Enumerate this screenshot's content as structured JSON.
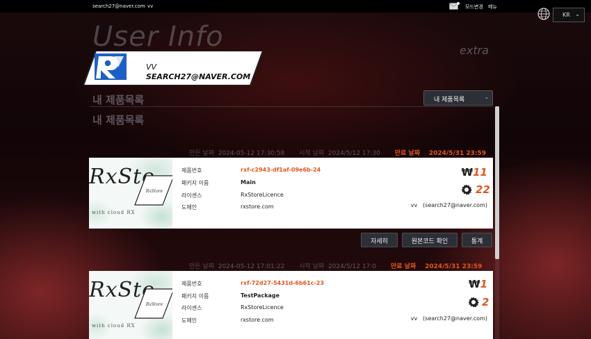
{
  "topbar": {
    "email": "search27@naver.com",
    "nickname": "vv",
    "mode_label": "모드변경",
    "menu_label": "메뉴"
  },
  "lang": {
    "selected": "KR",
    "icon": "globe-icon"
  },
  "page": {
    "title": "User Info",
    "extra": "extra",
    "banner_nickname": "VV",
    "banner_email": "SEARCH27@NAVER.COM",
    "section_title": "내 제품목록",
    "section_subtitle": "내 제품목록",
    "select_value": "내 제품목록"
  },
  "colors": {
    "accent": "#e2571e",
    "button": "#2c3036",
    "card": "#ffffff"
  },
  "products": [
    {
      "created_label": "만든 날짜",
      "created": "2024-05-12 17:30:58",
      "start_label": "시작 날짜",
      "start": "2024/5/12 17:30",
      "expire_label": "만료 날짜",
      "expire": "2024/5/31 23:59",
      "thumb_brand": "RxSto",
      "thumb_logo": "RxStore",
      "thumb_tagline": "with cloud RX",
      "labels": {
        "number": "제품번호",
        "package": "패키지 이름",
        "license": "라이센스",
        "domain": "도메인"
      },
      "number": "rxf-c2943-df1af-09e6b-24",
      "package": "Main",
      "license": "RxStoreLicence",
      "domain": "rxstore.com",
      "currency": "₩",
      "price": "11",
      "count": "22",
      "owner": "vv　(search27@naver.com)"
    },
    {
      "created_label": "만든 날짜",
      "created": "2024-05-12 17:01:22",
      "start_label": "시작 날짜",
      "start": "2024/5/12 17:0",
      "expire_label": "만료 날짜",
      "expire": "2024/5/31 23:59",
      "thumb_brand": "RxSto",
      "thumb_logo": "RxStore",
      "thumb_tagline": "with cloud RX",
      "labels": {
        "number": "제품번호",
        "package": "패키지 이름",
        "license": "라이센스",
        "domain": "도메인"
      },
      "number": "rxf-72d27-5431d-6b61c-23",
      "package": "TestPackage",
      "license": "RxStoreLicence",
      "domain": "rxstore.com",
      "currency": "₩",
      "price": "1",
      "count": "2",
      "owner": "vv　(search27@naver.com)"
    }
  ],
  "buttons": {
    "detail": "자세히",
    "source": "원본코드 확인",
    "stats": "통계"
  }
}
